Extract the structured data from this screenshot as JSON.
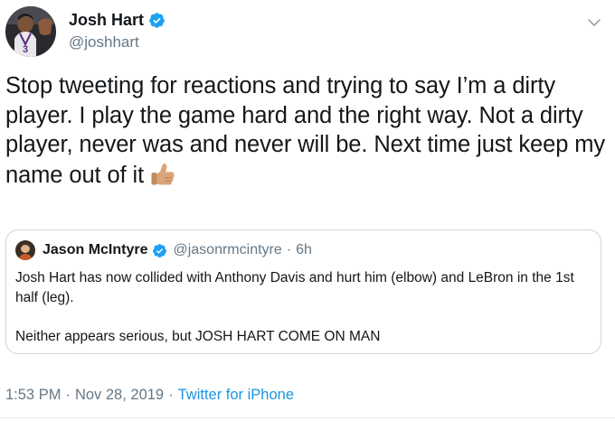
{
  "author": {
    "name": "Josh Hart",
    "handle": "@joshhart",
    "jersey_number": "3"
  },
  "tweet": {
    "text": "Stop tweeting for reactions and trying to say I’m a dirty player. I play the game hard and the right way. Not a dirty player, never was and never will be. Next time just keep my name out of it",
    "emoji": "thumbs-up"
  },
  "quoted_tweet": {
    "name": "Jason McIntyre",
    "handle": "@jasonrmcintyre",
    "separator": "·",
    "time": "6h",
    "paragraphs": [
      "Josh Hart has now collided with Anthony Davis and hurt him (elbow) and LeBron in the 1st half (leg).",
      "Neither appears serious, but JOSH HART COME ON MAN"
    ]
  },
  "meta": {
    "time": "1:53 PM",
    "separator": "·",
    "date": "Nov 28, 2019",
    "source": "Twitter for iPhone"
  },
  "icons": {
    "verified": "verified-badge-icon",
    "caret": "chevron-down-icon"
  },
  "colors": {
    "verified": "#1da1f2",
    "link": "#1b95e0",
    "secondary_text": "#657786",
    "border": "#ccd6dd"
  }
}
